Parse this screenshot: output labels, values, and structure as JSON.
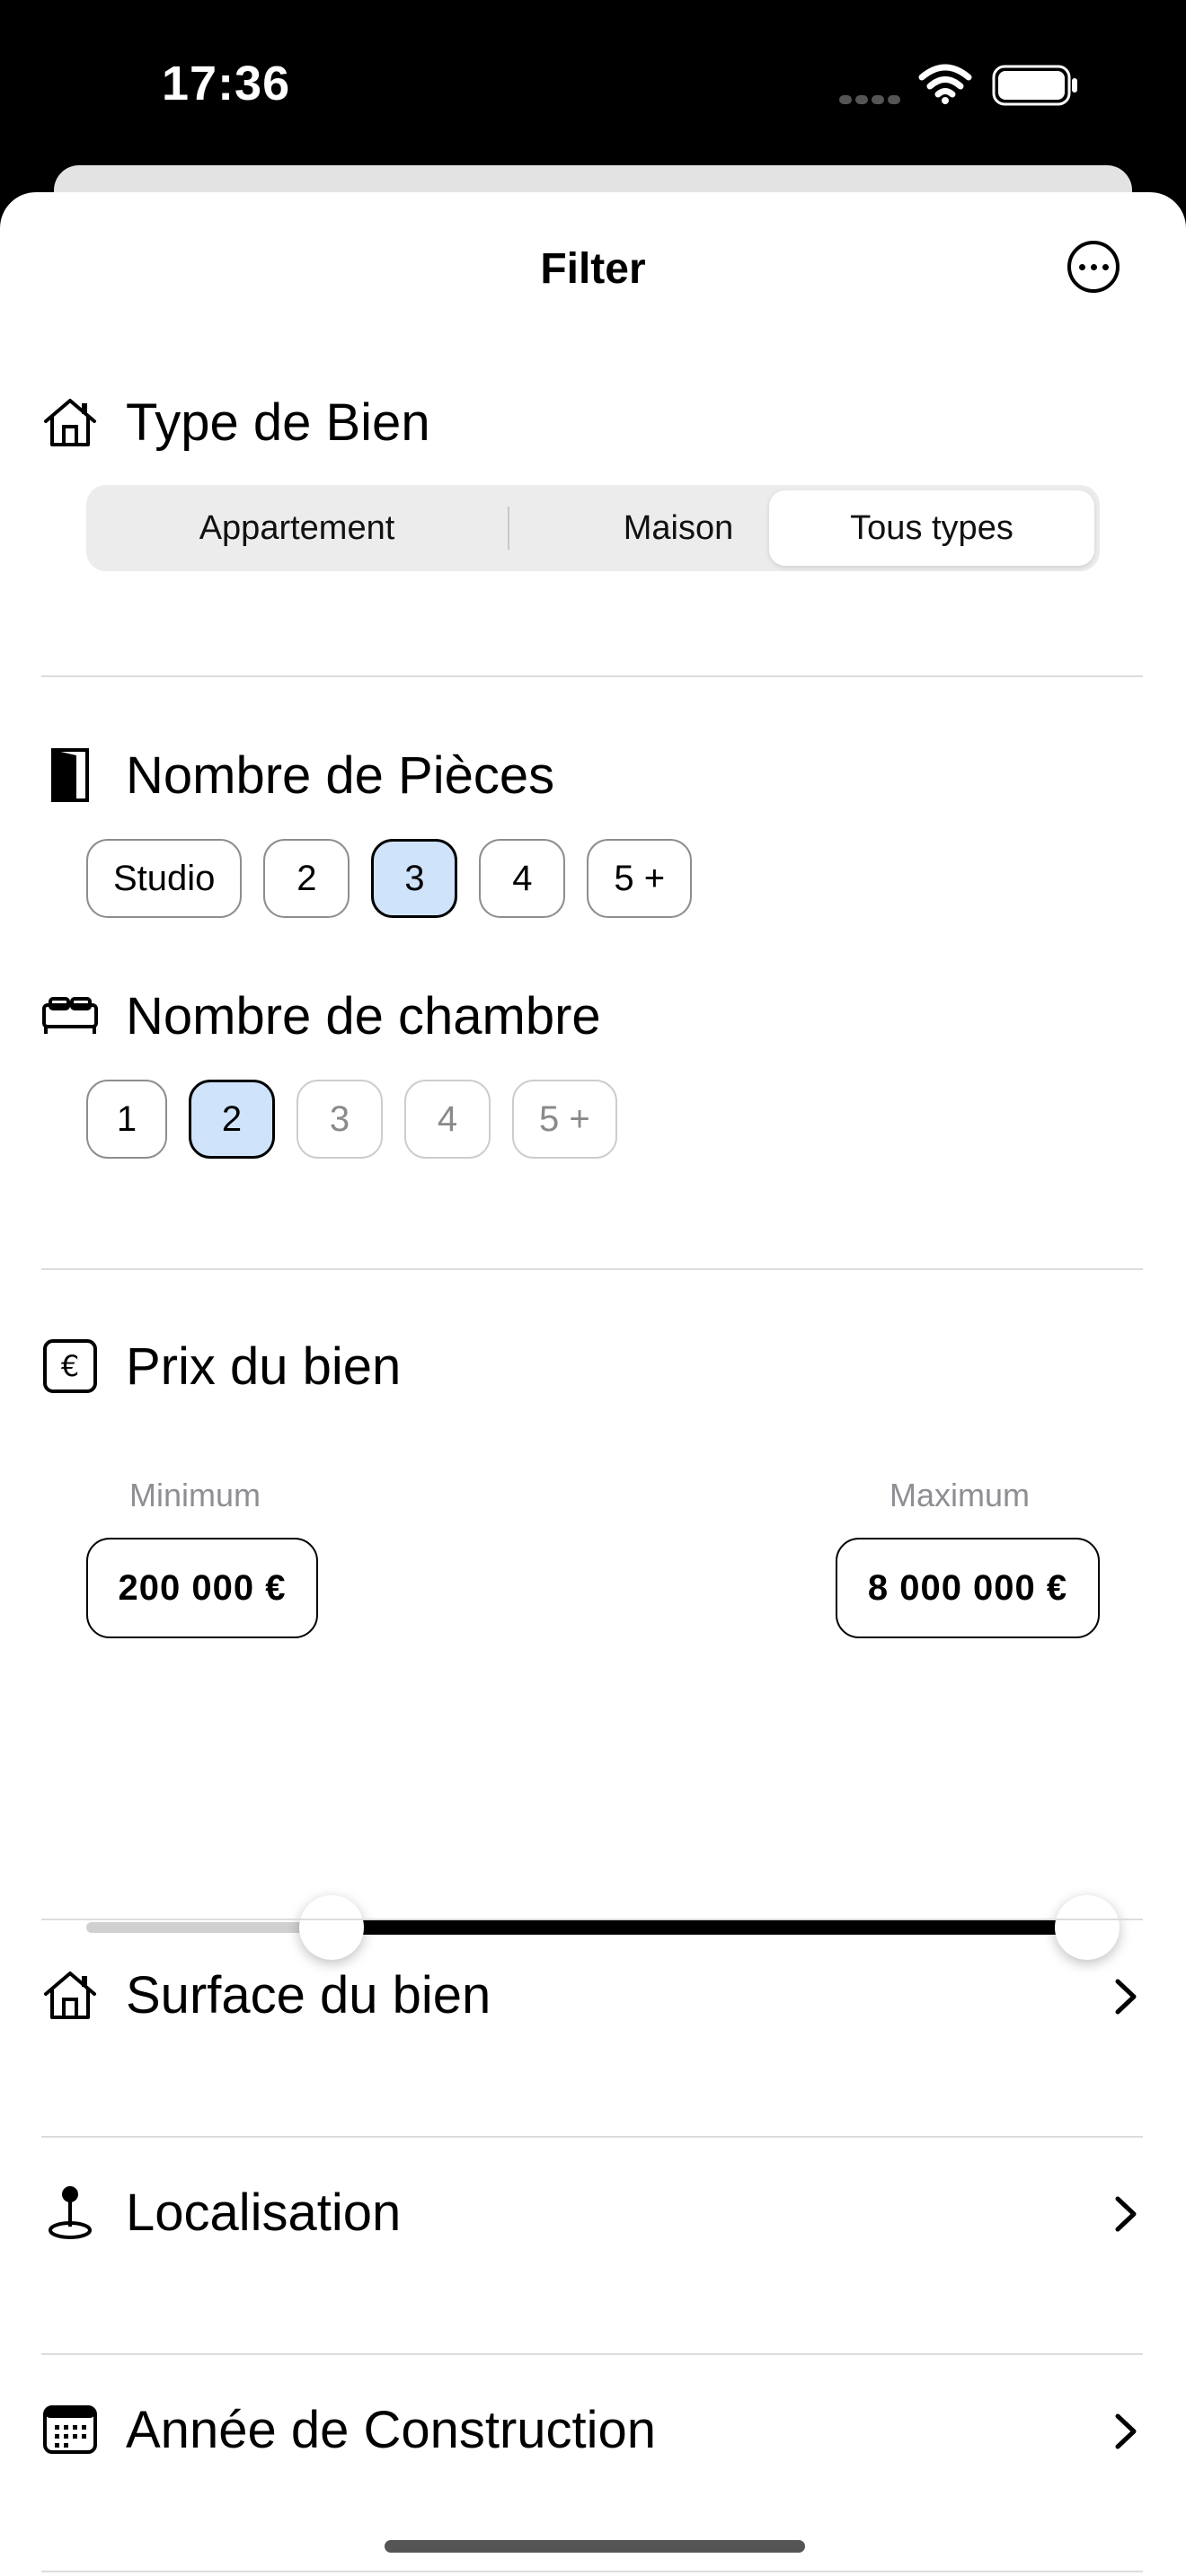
{
  "status_bar": {
    "time": "17:36"
  },
  "sheet": {
    "title": "Filter",
    "more_icon": "ellipsis-circle-icon"
  },
  "type_de_bien": {
    "title": "Type de Bien",
    "icon": "house-icon",
    "options": [
      "Appartement",
      "Maison",
      "Tous types"
    ],
    "selected": "Tous types"
  },
  "pieces": {
    "title": "Nombre de Pièces",
    "icon": "door-icon",
    "options": [
      "Studio",
      "2",
      "3",
      "4",
      "5 +"
    ],
    "selected": "3"
  },
  "chambres": {
    "title": "Nombre de chambre",
    "icon": "bed-icon",
    "options": [
      "1",
      "2",
      "3",
      "4",
      "5 +"
    ],
    "selected": "2",
    "disabled": [
      "3",
      "4",
      "5 +"
    ]
  },
  "prix": {
    "title": "Prix du bien",
    "icon": "euro-sign-icon",
    "min_label": "Minimum",
    "max_label": "Maximum",
    "min_value": "200 000 €",
    "max_value": "8 000 000 €",
    "slider_low_fraction": 0.22,
    "slider_high_fraction": 1.0
  },
  "rows": [
    {
      "title": "Surface du bien",
      "icon": "house-icon"
    },
    {
      "title": "Localisation",
      "icon": "map-pin-icon"
    },
    {
      "title": "Année de Construction",
      "icon": "calendar-icon"
    }
  ],
  "colors": {
    "selected_chip": "#cfe3fb",
    "accent": "#000000"
  }
}
